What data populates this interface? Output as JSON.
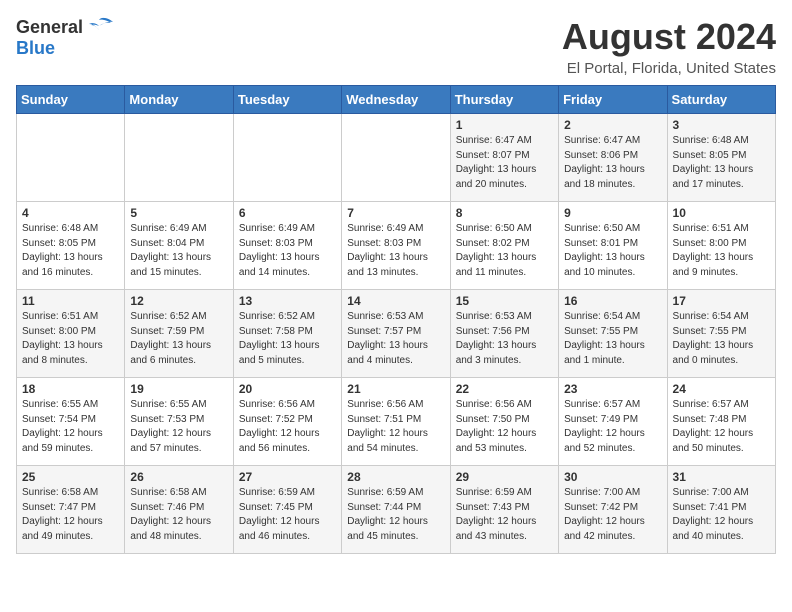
{
  "header": {
    "logo_general": "General",
    "logo_blue": "Blue",
    "month_year": "August 2024",
    "location": "El Portal, Florida, United States"
  },
  "days_of_week": [
    "Sunday",
    "Monday",
    "Tuesday",
    "Wednesday",
    "Thursday",
    "Friday",
    "Saturday"
  ],
  "weeks": [
    [
      {
        "day": "",
        "sunrise": "",
        "sunset": "",
        "daylight": ""
      },
      {
        "day": "",
        "sunrise": "",
        "sunset": "",
        "daylight": ""
      },
      {
        "day": "",
        "sunrise": "",
        "sunset": "",
        "daylight": ""
      },
      {
        "day": "",
        "sunrise": "",
        "sunset": "",
        "daylight": ""
      },
      {
        "day": "1",
        "sunrise": "Sunrise: 6:47 AM",
        "sunset": "Sunset: 8:07 PM",
        "daylight": "Daylight: 13 hours and 20 minutes."
      },
      {
        "day": "2",
        "sunrise": "Sunrise: 6:47 AM",
        "sunset": "Sunset: 8:06 PM",
        "daylight": "Daylight: 13 hours and 18 minutes."
      },
      {
        "day": "3",
        "sunrise": "Sunrise: 6:48 AM",
        "sunset": "Sunset: 8:05 PM",
        "daylight": "Daylight: 13 hours and 17 minutes."
      }
    ],
    [
      {
        "day": "4",
        "sunrise": "Sunrise: 6:48 AM",
        "sunset": "Sunset: 8:05 PM",
        "daylight": "Daylight: 13 hours and 16 minutes."
      },
      {
        "day": "5",
        "sunrise": "Sunrise: 6:49 AM",
        "sunset": "Sunset: 8:04 PM",
        "daylight": "Daylight: 13 hours and 15 minutes."
      },
      {
        "day": "6",
        "sunrise": "Sunrise: 6:49 AM",
        "sunset": "Sunset: 8:03 PM",
        "daylight": "Daylight: 13 hours and 14 minutes."
      },
      {
        "day": "7",
        "sunrise": "Sunrise: 6:49 AM",
        "sunset": "Sunset: 8:03 PM",
        "daylight": "Daylight: 13 hours and 13 minutes."
      },
      {
        "day": "8",
        "sunrise": "Sunrise: 6:50 AM",
        "sunset": "Sunset: 8:02 PM",
        "daylight": "Daylight: 13 hours and 11 minutes."
      },
      {
        "day": "9",
        "sunrise": "Sunrise: 6:50 AM",
        "sunset": "Sunset: 8:01 PM",
        "daylight": "Daylight: 13 hours and 10 minutes."
      },
      {
        "day": "10",
        "sunrise": "Sunrise: 6:51 AM",
        "sunset": "Sunset: 8:00 PM",
        "daylight": "Daylight: 13 hours and 9 minutes."
      }
    ],
    [
      {
        "day": "11",
        "sunrise": "Sunrise: 6:51 AM",
        "sunset": "Sunset: 8:00 PM",
        "daylight": "Daylight: 13 hours and 8 minutes."
      },
      {
        "day": "12",
        "sunrise": "Sunrise: 6:52 AM",
        "sunset": "Sunset: 7:59 PM",
        "daylight": "Daylight: 13 hours and 6 minutes."
      },
      {
        "day": "13",
        "sunrise": "Sunrise: 6:52 AM",
        "sunset": "Sunset: 7:58 PM",
        "daylight": "Daylight: 13 hours and 5 minutes."
      },
      {
        "day": "14",
        "sunrise": "Sunrise: 6:53 AM",
        "sunset": "Sunset: 7:57 PM",
        "daylight": "Daylight: 13 hours and 4 minutes."
      },
      {
        "day": "15",
        "sunrise": "Sunrise: 6:53 AM",
        "sunset": "Sunset: 7:56 PM",
        "daylight": "Daylight: 13 hours and 3 minutes."
      },
      {
        "day": "16",
        "sunrise": "Sunrise: 6:54 AM",
        "sunset": "Sunset: 7:55 PM",
        "daylight": "Daylight: 13 hours and 1 minute."
      },
      {
        "day": "17",
        "sunrise": "Sunrise: 6:54 AM",
        "sunset": "Sunset: 7:55 PM",
        "daylight": "Daylight: 13 hours and 0 minutes."
      }
    ],
    [
      {
        "day": "18",
        "sunrise": "Sunrise: 6:55 AM",
        "sunset": "Sunset: 7:54 PM",
        "daylight": "Daylight: 12 hours and 59 minutes."
      },
      {
        "day": "19",
        "sunrise": "Sunrise: 6:55 AM",
        "sunset": "Sunset: 7:53 PM",
        "daylight": "Daylight: 12 hours and 57 minutes."
      },
      {
        "day": "20",
        "sunrise": "Sunrise: 6:56 AM",
        "sunset": "Sunset: 7:52 PM",
        "daylight": "Daylight: 12 hours and 56 minutes."
      },
      {
        "day": "21",
        "sunrise": "Sunrise: 6:56 AM",
        "sunset": "Sunset: 7:51 PM",
        "daylight": "Daylight: 12 hours and 54 minutes."
      },
      {
        "day": "22",
        "sunrise": "Sunrise: 6:56 AM",
        "sunset": "Sunset: 7:50 PM",
        "daylight": "Daylight: 12 hours and 53 minutes."
      },
      {
        "day": "23",
        "sunrise": "Sunrise: 6:57 AM",
        "sunset": "Sunset: 7:49 PM",
        "daylight": "Daylight: 12 hours and 52 minutes."
      },
      {
        "day": "24",
        "sunrise": "Sunrise: 6:57 AM",
        "sunset": "Sunset: 7:48 PM",
        "daylight": "Daylight: 12 hours and 50 minutes."
      }
    ],
    [
      {
        "day": "25",
        "sunrise": "Sunrise: 6:58 AM",
        "sunset": "Sunset: 7:47 PM",
        "daylight": "Daylight: 12 hours and 49 minutes."
      },
      {
        "day": "26",
        "sunrise": "Sunrise: 6:58 AM",
        "sunset": "Sunset: 7:46 PM",
        "daylight": "Daylight: 12 hours and 48 minutes."
      },
      {
        "day": "27",
        "sunrise": "Sunrise: 6:59 AM",
        "sunset": "Sunset: 7:45 PM",
        "daylight": "Daylight: 12 hours and 46 minutes."
      },
      {
        "day": "28",
        "sunrise": "Sunrise: 6:59 AM",
        "sunset": "Sunset: 7:44 PM",
        "daylight": "Daylight: 12 hours and 45 minutes."
      },
      {
        "day": "29",
        "sunrise": "Sunrise: 6:59 AM",
        "sunset": "Sunset: 7:43 PM",
        "daylight": "Daylight: 12 hours and 43 minutes."
      },
      {
        "day": "30",
        "sunrise": "Sunrise: 7:00 AM",
        "sunset": "Sunset: 7:42 PM",
        "daylight": "Daylight: 12 hours and 42 minutes."
      },
      {
        "day": "31",
        "sunrise": "Sunrise: 7:00 AM",
        "sunset": "Sunset: 7:41 PM",
        "daylight": "Daylight: 12 hours and 40 minutes."
      }
    ]
  ]
}
